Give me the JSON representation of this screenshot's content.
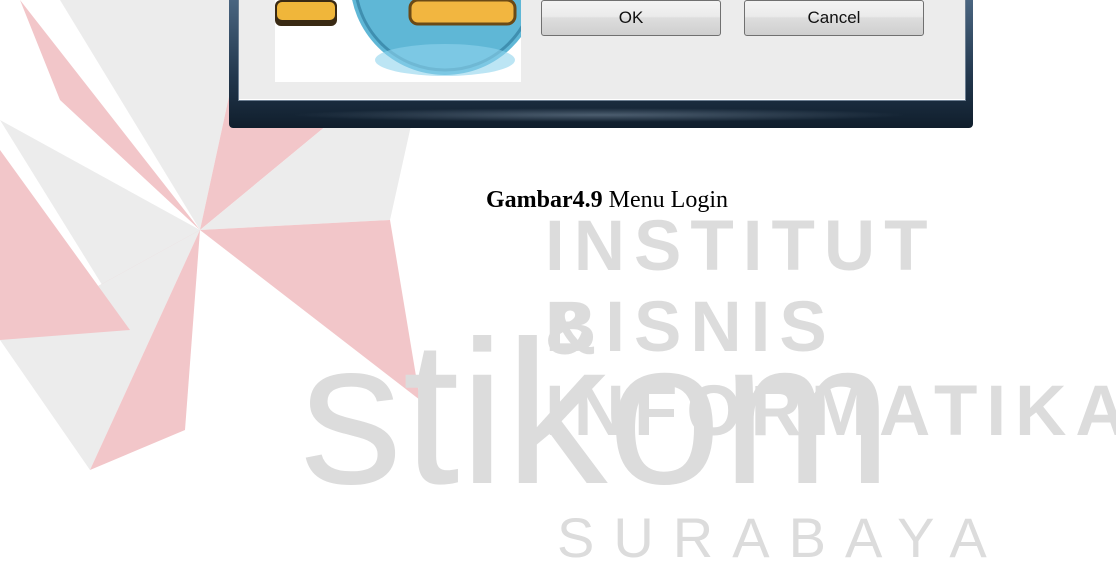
{
  "watermark": {
    "line1": "INSTITUT BISNIS",
    "line2": "& INFORMATIKA",
    "brand": "stikom",
    "line3": "SURABAYA",
    "colors": {
      "red": "#f2c6c9",
      "gray": "#dcdcdc"
    }
  },
  "dialog": {
    "ok_label": "OK",
    "cancel_label": "Cancel",
    "logo_icon": "app-logo-icon"
  },
  "caption": {
    "figure_label": "Gambar4.9",
    "text": "Menu Login"
  }
}
